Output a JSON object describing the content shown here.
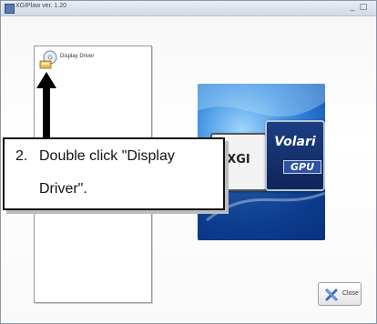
{
  "window": {
    "title": "XGIPlaw ver. 1.20",
    "minimize_glyph": "_",
    "maximize_glyph": "□"
  },
  "list": {
    "items": [
      {
        "label": "Display Driver",
        "icon": "disc-install-icon"
      }
    ]
  },
  "logo": {
    "left_badge": "XGI",
    "right_badge": "Volari",
    "right_badge_sub": "GPU"
  },
  "close_button": {
    "label": "Close",
    "icon": "close-x-icon"
  },
  "callout": {
    "number": "2.",
    "line1": "Double click \"Display",
    "line2": "Driver\"."
  },
  "colors": {
    "titlebar": "#d3dae5",
    "logo_blue": "#1256b8",
    "callout_border": "#111111"
  }
}
